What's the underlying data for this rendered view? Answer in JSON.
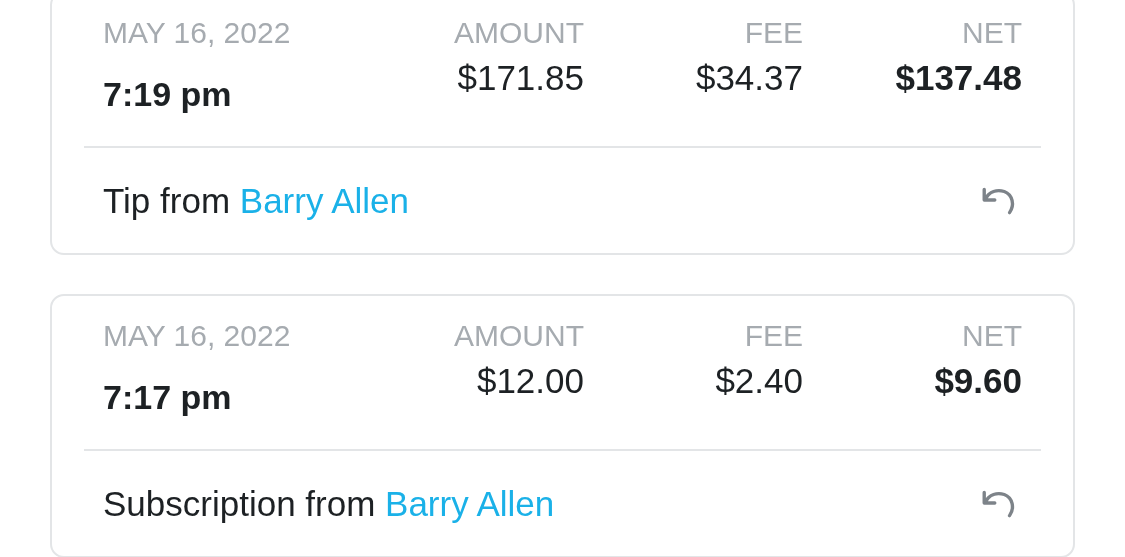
{
  "transactions": [
    {
      "date": "MAY 16, 2022",
      "time": "7:19 pm",
      "amount_label": "AMOUNT",
      "amount": "$171.85",
      "fee_label": "FEE",
      "fee": "$34.37",
      "net_label": "NET",
      "net": "$137.48",
      "description": "Tip from",
      "user": "Barry Allen"
    },
    {
      "date": "MAY 16, 2022",
      "time": "7:17 pm",
      "amount_label": "AMOUNT",
      "amount": "$12.00",
      "fee_label": "FEE",
      "fee": "$2.40",
      "net_label": "NET",
      "net": "$9.60",
      "description": "Subscription from",
      "user": "Barry Allen"
    }
  ]
}
